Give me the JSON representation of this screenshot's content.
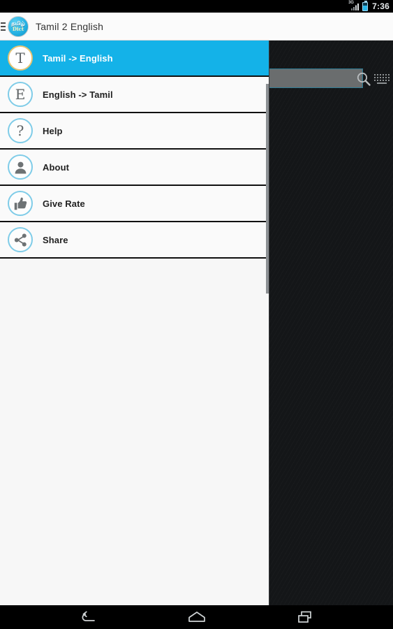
{
  "statusbar": {
    "network_label": "3G",
    "signal_icon": "signal-bars-icon",
    "battery_icon": "battery-icon",
    "time": "7:36"
  },
  "appbar": {
    "menu_icon": "hamburger-menu-icon",
    "app_icon_line1": "தமிழ்",
    "app_icon_line2": "Dict",
    "title": "Tamil 2 English"
  },
  "drawer": {
    "items": [
      {
        "label": "Tamil -> English",
        "glyph": "T",
        "icon_name": "letter-t-icon",
        "selected": true
      },
      {
        "label": "English -> Tamil",
        "glyph": "E",
        "icon_name": "letter-e-icon",
        "selected": false
      },
      {
        "label": "Help",
        "glyph": "?",
        "icon_name": "question-mark-icon",
        "selected": false
      },
      {
        "label": "About",
        "glyph": "person",
        "icon_name": "person-icon",
        "selected": false
      },
      {
        "label": "Give Rate",
        "glyph": "thumbsup",
        "icon_name": "thumbs-up-icon",
        "selected": false
      },
      {
        "label": "Share",
        "glyph": "share",
        "icon_name": "share-nodes-icon",
        "selected": false
      }
    ]
  },
  "content": {
    "search_value": "",
    "search_placeholder": "",
    "search_icon": "magnifier-icon",
    "keyboard_icon": "keyboard-icon"
  },
  "navbar": {
    "back_label": "Back",
    "home_label": "Home",
    "recents_label": "Recent apps"
  },
  "colors": {
    "accent_cyan": "#14b2e8",
    "icon_border": "#7fcce8",
    "selected_icon_border": "#e4c373",
    "drawer_bg": "#f7f7f7",
    "content_bg": "#141618",
    "divider": "#101010",
    "search_field_bg": "#6a6d6e",
    "search_field_border": "#2e7d96"
  }
}
